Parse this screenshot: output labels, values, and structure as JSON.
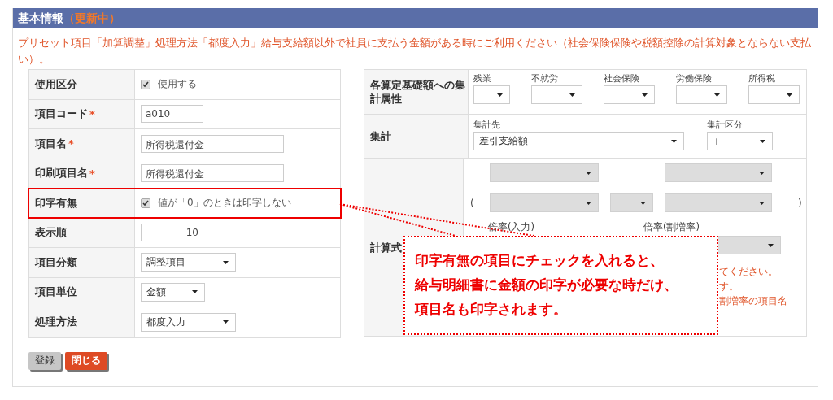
{
  "header": {
    "title": "基本情報",
    "status": "（更新中）"
  },
  "notice": "プリセット項目「加算調整」処理方法「都度入力」給与支給額以外で社員に支払う金額がある時にご利用ください（社会保険保険や税額控除の計算対象とならない支払い）。",
  "left_rows": [
    {
      "label": "使用区分",
      "kind": "checkbox",
      "checked": true,
      "text": "使用する"
    },
    {
      "label": "項目コード",
      "required_mark": "*",
      "kind": "code",
      "value": "a010"
    },
    {
      "label": "項目名",
      "required_mark": "*",
      "kind": "name",
      "value": "所得税還付金"
    },
    {
      "label": "印刷項目名",
      "required_mark": "*",
      "kind": "name",
      "value": "所得税還付金"
    },
    {
      "label": "印字有無",
      "kind": "checkbox",
      "checked": true,
      "text": "値が「0」のときは印字しない",
      "highlighted": true
    },
    {
      "label": "表示順",
      "kind": "number",
      "value": "10"
    },
    {
      "label": "項目分類",
      "kind": "select",
      "value": "調整項目"
    },
    {
      "label": "項目単位",
      "kind": "select_short",
      "value": "金額"
    },
    {
      "label": "処理方法",
      "kind": "select",
      "value": "都度入力"
    }
  ],
  "aggregation_attributes": {
    "label": "各算定基礎額への集計属性",
    "selects": [
      {
        "label": "残業"
      },
      {
        "label": "不就労"
      },
      {
        "label": "社会保険"
      },
      {
        "label": "労働保険"
      },
      {
        "label": "所得税"
      }
    ]
  },
  "aggregation": {
    "label": "集計",
    "destination": {
      "label": "集計先",
      "value": "差引支給額"
    },
    "division": {
      "label": "集計区分",
      "value": "+"
    }
  },
  "formula": {
    "label": "計算式",
    "disabled": true,
    "open_paren": "(",
    "close_paren": ")",
    "rate_input_label": "倍率(入力)",
    "rate_premium_label": "倍率(割増率)",
    "notes": [
      "てください。",
      "す。",
      "割増率の項目名"
    ]
  },
  "callout": {
    "lines": [
      "印字有無の項目にチェックを入れると、",
      "給与明細書に金額の印字が必要な時だけ、",
      "項目名も印字されます。"
    ]
  },
  "buttons": [
    {
      "label": "登録",
      "kind": "secondary"
    },
    {
      "label": "閉じる",
      "kind": "primary"
    }
  ]
}
